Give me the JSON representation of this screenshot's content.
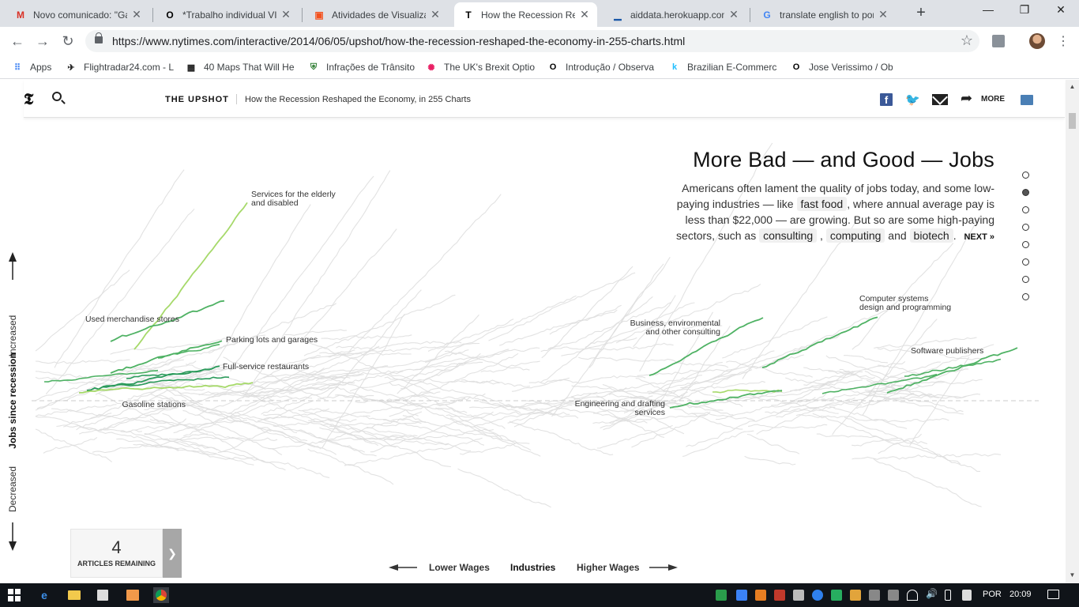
{
  "browser": {
    "tabs": [
      {
        "title": "Novo comunicado: \"Ga",
        "favicon": "gmail-icon",
        "color": "#d93025",
        "glyph": "M"
      },
      {
        "title": "*Trabalho individual VIS",
        "favicon": "observable-icon",
        "color": "#000000",
        "glyph": "O"
      },
      {
        "title": "Atividades de Visualizaç",
        "favicon": "classroom-icon",
        "color": "#f4511e",
        "glyph": "▣"
      },
      {
        "title": "How the Recession Resh",
        "favicon": "nyt-icon",
        "color": "#000000",
        "glyph": "T"
      },
      {
        "title": "aiddata.herokuapp.com",
        "favicon": "aiddata-icon",
        "color": "#1a57a8",
        "glyph": "▁"
      },
      {
        "title": "translate english to por",
        "favicon": "google-icon",
        "color": "#4285f4",
        "glyph": "G"
      }
    ],
    "active_tab": 3,
    "url": "https://www.nytimes.com/interactive/2014/06/05/upshot/how-the-recession-reshaped-the-economy-in-255-charts.html",
    "bookmarks": [
      {
        "label": "Apps",
        "icon": "apps-grid-icon",
        "color": "#4285f4",
        "glyph": "⠿"
      },
      {
        "label": "Flightradar24.com - L",
        "icon": "flightradar-icon",
        "color": "#222222",
        "glyph": "✈"
      },
      {
        "label": "40 Maps That Will He",
        "icon": "maps-icon",
        "color": "#222222",
        "glyph": "▩"
      },
      {
        "label": "Infrações de Trânsito",
        "icon": "traffic-icon",
        "color": "#2e7d32",
        "glyph": "⛨"
      },
      {
        "label": "The UK's Brexit Optio",
        "icon": "brexit-icon",
        "color": "#e91e63",
        "glyph": "✺"
      },
      {
        "label": "Introdução / Observa",
        "icon": "observable-icon",
        "color": "#000000",
        "glyph": "O"
      },
      {
        "label": "Brazilian E-Commerc",
        "icon": "kaggle-icon",
        "color": "#20beff",
        "glyph": "k"
      },
      {
        "label": "Jose Verissimo / Obs",
        "icon": "observable-icon",
        "color": "#000000",
        "glyph": "O"
      }
    ]
  },
  "nyt": {
    "section": "THE UPSHOT",
    "title": "How the Recession Reshaped the Economy, in 255 Charts",
    "more_label": "MORE",
    "colors": {
      "facebook": "#3b5998",
      "twitter": "#1da1f2"
    }
  },
  "story": {
    "title": "More Bad — and Good — Jobs",
    "body_1": "Americans often lament the quality of jobs today, and some low-paying industries — like",
    "chip_fast_food": "fast food",
    "body_2": ", where annual average pay is less than $22,000 — are growing. But so are some high-paying sectors, such as",
    "chip_consulting": "consulting",
    "comma": ",",
    "chip_computing": "computing",
    "and": "and",
    "chip_biotech": "biotech",
    "period": ".",
    "next": "NEXT »"
  },
  "nav_dots": {
    "count": 8,
    "active": 1
  },
  "counter": {
    "number": "4",
    "label": "ARTICLES REMAINING"
  },
  "chart_data": {
    "type": "line",
    "y_axis": {
      "top": "Increased",
      "middle": "Jobs since recession",
      "bottom": "Decreased"
    },
    "x_axis": {
      "left": "Lower Wages",
      "center": "Industries",
      "right": "Higher Wages"
    },
    "highlight_colors": {
      "light": "#a6d96a",
      "medium": "#4fb264",
      "dark": "#2a9a5a"
    },
    "labeled_industries": [
      "Services for the elderly and disabled",
      "Used merchandise stores",
      "Parking lots and garages",
      "Full-service restaurants",
      "Gasoline stations",
      "Business, environmental and other consulting",
      "Engineering and drafting services",
      "Computer systems design and programming",
      "Software publishers"
    ],
    "background_series_count": 255
  },
  "taskbar": {
    "language": "POR",
    "time": "20:09"
  }
}
